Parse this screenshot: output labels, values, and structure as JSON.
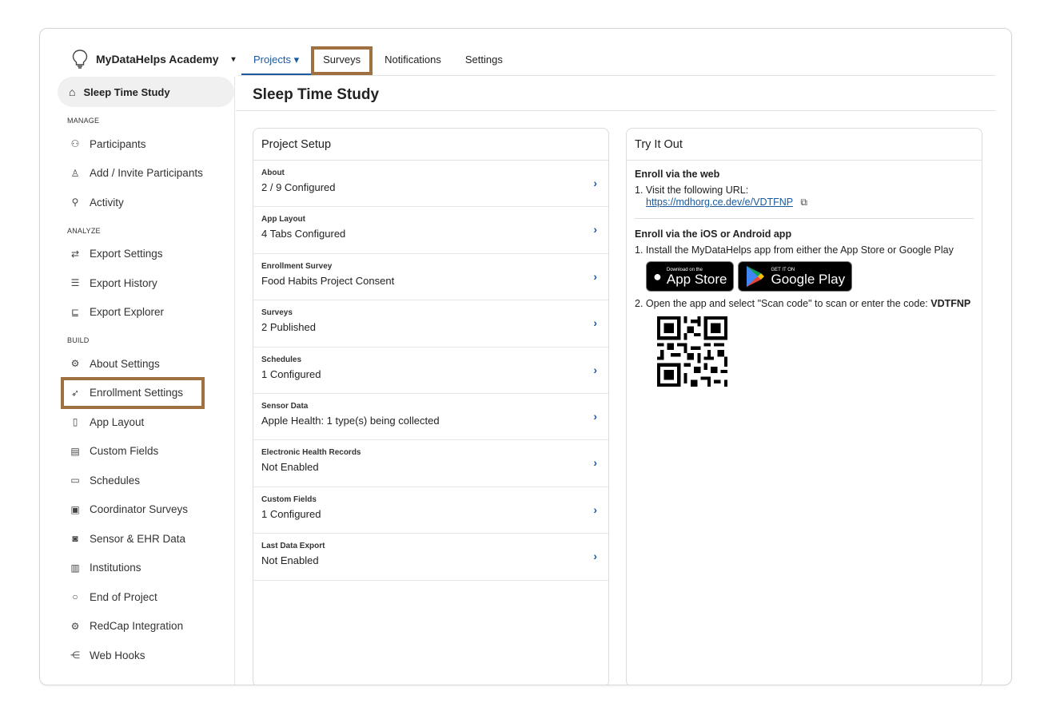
{
  "brand": {
    "name": "MyDataHelps Academy",
    "caret": "▾"
  },
  "tabs": [
    {
      "label": "Projects ▾"
    },
    {
      "label": "Surveys"
    },
    {
      "label": "Notifications"
    },
    {
      "label": "Settings"
    }
  ],
  "sidebar": {
    "home": "Sleep Time Study",
    "sections": {
      "manage": "MANAGE",
      "analyze": "ANALYZE",
      "build": "BUILD"
    },
    "manage_items": [
      {
        "label": "Participants",
        "icon": "participants-icon"
      },
      {
        "label": "Add / Invite Participants",
        "icon": "add-user-icon"
      },
      {
        "label": "Activity",
        "icon": "search-icon"
      }
    ],
    "analyze_items": [
      {
        "label": "Export Settings",
        "icon": "swap-icon"
      },
      {
        "label": "Export History",
        "icon": "list-icon"
      },
      {
        "label": "Export Explorer",
        "icon": "explorer-icon"
      }
    ],
    "build_items": [
      {
        "label": "About Settings",
        "icon": "gear-icon"
      },
      {
        "label": "Enrollment Settings",
        "icon": "rocket-icon"
      },
      {
        "label": "App Layout",
        "icon": "phone-icon"
      },
      {
        "label": "Custom Fields",
        "icon": "id-card-icon"
      },
      {
        "label": "Schedules",
        "icon": "calendar-icon"
      },
      {
        "label": "Coordinator Surveys",
        "icon": "clipboard-icon"
      },
      {
        "label": "Sensor & EHR Data",
        "icon": "watch-icon"
      },
      {
        "label": "Institutions",
        "icon": "building-icon"
      },
      {
        "label": "End of Project",
        "icon": "circle-icon"
      },
      {
        "label": "RedCap Integration",
        "icon": "gears-icon"
      },
      {
        "label": "Web Hooks",
        "icon": "share-icon"
      }
    ]
  },
  "main": {
    "title": "Sleep Time Study"
  },
  "setup": {
    "title": "Project Setup",
    "rows": [
      {
        "label": "About",
        "value": "2 / 9 Configured"
      },
      {
        "label": "App Layout",
        "value": "4 Tabs Configured"
      },
      {
        "label": "Enrollment Survey",
        "value": "Food Habits Project Consent"
      },
      {
        "label": "Surveys",
        "value": "2 Published"
      },
      {
        "label": "Schedules",
        "value": "1 Configured"
      },
      {
        "label": "Sensor Data",
        "value": "Apple Health: 1 type(s) being collected"
      },
      {
        "label": "Electronic Health Records",
        "value": "Not Enabled"
      },
      {
        "label": "Custom Fields",
        "value": "1 Configured"
      },
      {
        "label": "Last Data Export",
        "value": "Not Enabled"
      }
    ]
  },
  "try": {
    "title": "Try It Out",
    "web_heading": "Enroll via the web",
    "web_step": "1. Visit the following URL:",
    "url": "https://mdhorg.ce.dev/e/VDTFNP",
    "app_heading": "Enroll via the iOS or Android app",
    "app_step1": "1. Install the MyDataHelps app from either the App Store or Google Play",
    "appstore_small": "Download on the",
    "appstore_big": "App Store",
    "gplay_small": "GET IT ON",
    "gplay_big": "Google Play",
    "app_step2_prefix": "2. Open the app and select \"Scan code\" to scan or enter the code: ",
    "code": "VDTFNP"
  }
}
